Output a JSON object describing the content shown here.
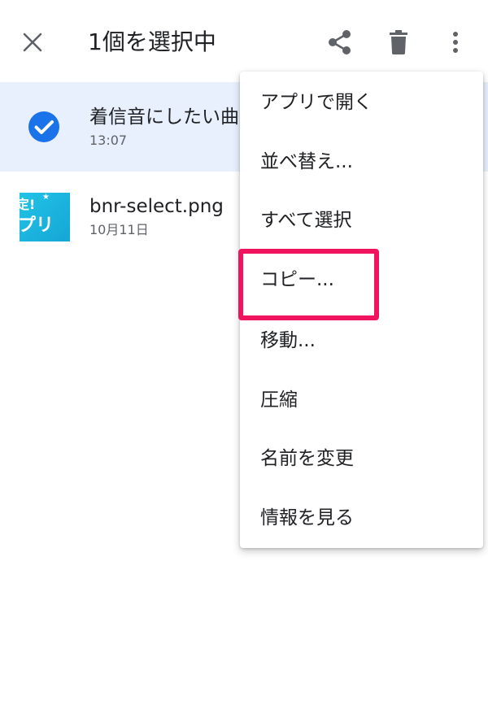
{
  "topbar": {
    "title": "1個を選択中"
  },
  "files": [
    {
      "name": "着信音にしたい曲",
      "date": "13:07",
      "selected": true
    },
    {
      "name": "bnr-select.png",
      "date": "10月11日",
      "selected": false,
      "thumb_text_1": "定!",
      "thumb_text_2": "プリ"
    }
  ],
  "menu": {
    "items": [
      {
        "label": "アプリで開く"
      },
      {
        "label": "並べ替え..."
      },
      {
        "label": "すべて選択"
      },
      {
        "label": "コピー..."
      },
      {
        "label": "移動..."
      },
      {
        "label": "圧縮"
      },
      {
        "label": "名前を変更"
      },
      {
        "label": "情報を見る"
      }
    ]
  },
  "colors": {
    "selected_row_bg": "#e8f0fe",
    "check_blue": "#1a73e8",
    "icon_gray": "#5f6368",
    "highlight_pink": "#f0145f"
  },
  "icons": {
    "close": "close-icon",
    "share": "share-icon",
    "delete": "trash-icon",
    "more": "more-vert-icon",
    "check": "check-circle-icon"
  }
}
